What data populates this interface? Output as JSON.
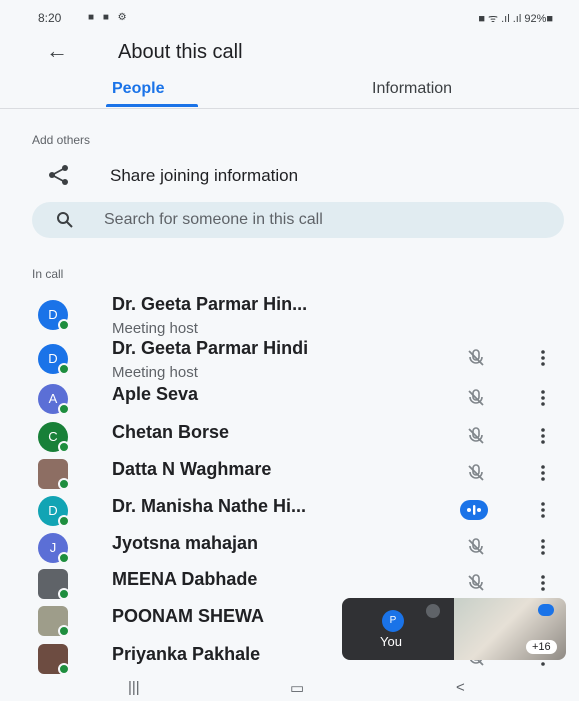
{
  "status": {
    "time": "8:20",
    "left_icons": "■ ■ ⚙",
    "right": "■ ᯤ .ıl .ıl 92%■"
  },
  "appbar": {
    "back_icon": "arrow-left-icon",
    "title": "About this call"
  },
  "tabs": [
    {
      "label": "People",
      "selected": true
    },
    {
      "label": "Information",
      "selected": false
    }
  ],
  "add_others": {
    "heading": "Add others",
    "share_label": "Share joining information"
  },
  "search": {
    "placeholder": "Search for someone in this call"
  },
  "in_call": {
    "heading": "In call",
    "people": [
      {
        "name": "Dr. Geeta Parmar Hin...",
        "sub": "Meeting host",
        "initial": "D",
        "color": "#1a73e8",
        "photo": false,
        "mic": "none"
      },
      {
        "name": "Dr. Geeta Parmar Hindi",
        "sub": "Meeting host",
        "initial": "D",
        "color": "#1a73e8",
        "photo": false,
        "mic": "muted"
      },
      {
        "name": "Aple Seva",
        "sub": "",
        "initial": "A",
        "color": "#5b6fd6",
        "photo": false,
        "mic": "muted"
      },
      {
        "name": "Chetan Borse",
        "sub": "",
        "initial": "C",
        "color": "#188038",
        "photo": false,
        "mic": "muted"
      },
      {
        "name": "Datta N Waghmare",
        "sub": "",
        "initial": "",
        "color": "#8d6e63",
        "photo": true,
        "mic": "muted"
      },
      {
        "name": "Dr. Manisha Nathe Hi...",
        "sub": "",
        "initial": "D",
        "color": "#12a4b4",
        "photo": false,
        "mic": "speaking"
      },
      {
        "name": "Jyotsna mahajan",
        "sub": "",
        "initial": "J",
        "color": "#5b6fd6",
        "photo": false,
        "mic": "muted"
      },
      {
        "name": "MEENA Dabhade",
        "sub": "",
        "initial": "",
        "color": "#5f6368",
        "photo": true,
        "mic": "muted"
      },
      {
        "name": "POONAM SHEWA",
        "sub": "",
        "initial": "",
        "color": "#9e9d8a",
        "photo": true,
        "mic": "muted"
      },
      {
        "name": "Priyanka Pakhale",
        "sub": "",
        "initial": "",
        "color": "#6d4c41",
        "photo": true,
        "mic": "muted"
      }
    ]
  },
  "self_tile": {
    "initial": "P",
    "label": "You",
    "more_count": "+16"
  },
  "navbar": {
    "recent": "|||",
    "home": "▭",
    "back": "<"
  },
  "colors": {
    "accent": "#1a73e8",
    "online": "#1e8e3e",
    "search_bg": "#e1ecf1"
  }
}
